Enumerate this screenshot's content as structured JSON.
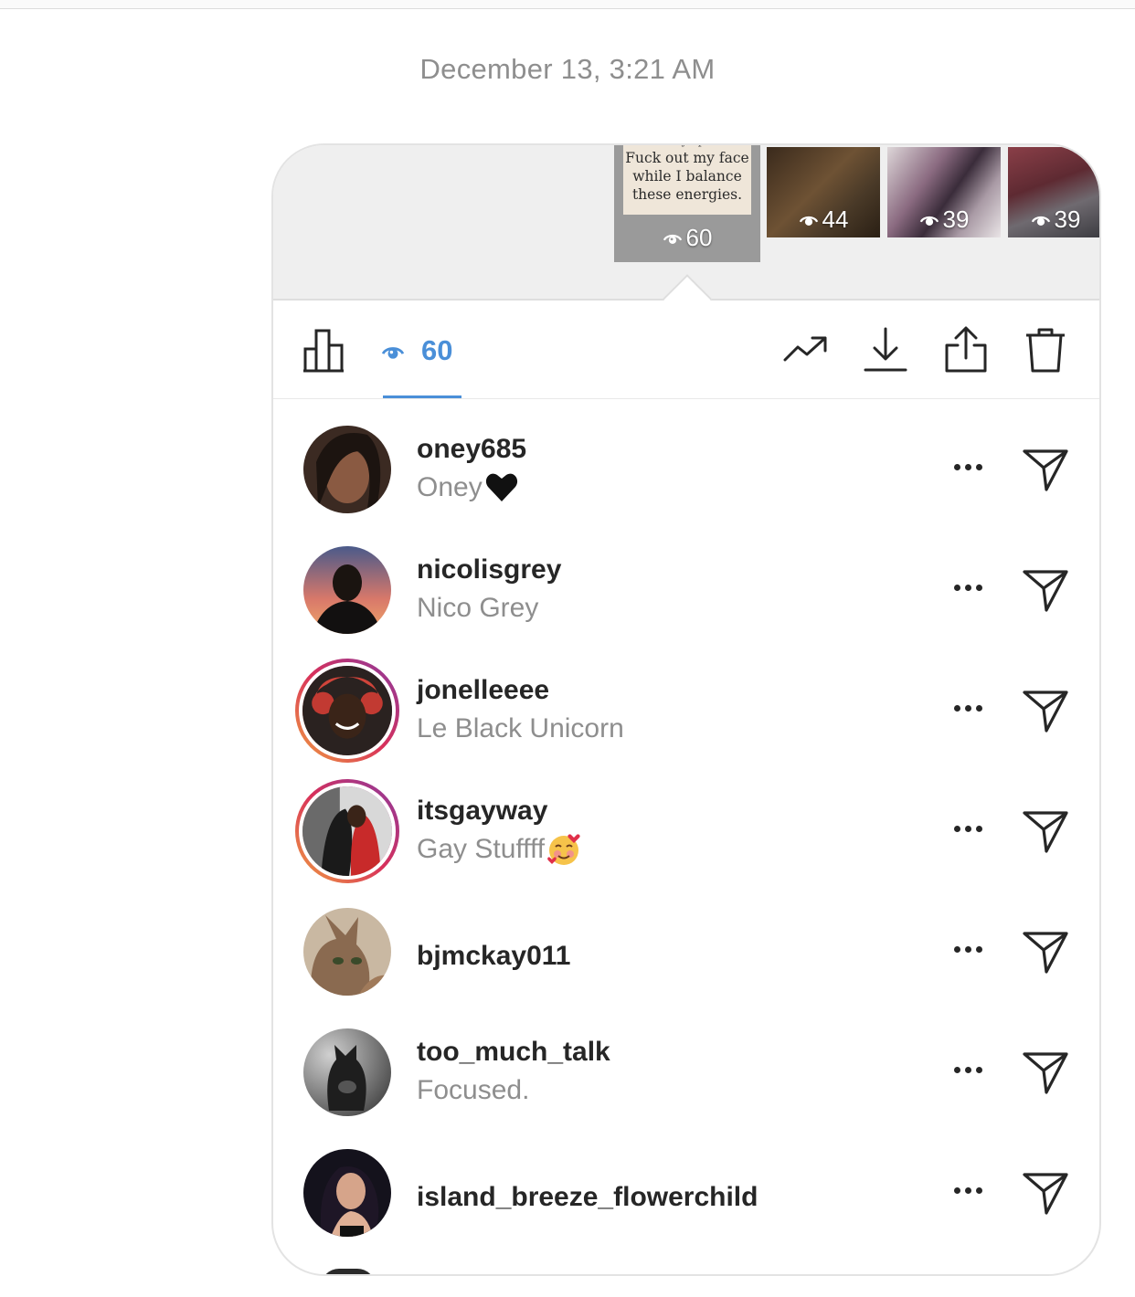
{
  "timestamp": "December 13, 3:21 AM",
  "stories": [
    {
      "quote_top": "are always positive",
      "quote": "Fuck out my face while I balance these energies.",
      "views": "60",
      "selected": true
    },
    {
      "views": "44"
    },
    {
      "views": "39"
    },
    {
      "views": "39"
    }
  ],
  "toolbar": {
    "insights_icon": "bar-chart-icon",
    "viewer_icon": "eye-icon",
    "viewer_count": "60",
    "promote_icon": "trending-up-icon",
    "download_icon": "download-icon",
    "share_icon": "share-icon",
    "delete_icon": "trash-icon",
    "accent_color": "#4a8fd8"
  },
  "viewers": [
    {
      "username": "oney685",
      "full_name": "Oney",
      "emoji": "black-heart",
      "has_story_ring": false
    },
    {
      "username": "nicolisgrey",
      "full_name": "Nico Grey",
      "emoji": "",
      "has_story_ring": false
    },
    {
      "username": "jonelleeee",
      "full_name": "Le Black Unicorn",
      "emoji": "",
      "has_story_ring": true
    },
    {
      "username": "itsgayway",
      "full_name": "Gay Stuffff",
      "emoji": "smiling-face-with-hearts",
      "has_story_ring": true
    },
    {
      "username": "bjmckay011",
      "full_name": "",
      "emoji": "",
      "has_story_ring": false
    },
    {
      "username": "too_much_talk",
      "full_name": "Focused.",
      "emoji": "",
      "has_story_ring": false
    },
    {
      "username": "island_breeze_flowerchild",
      "full_name": "",
      "emoji": "",
      "has_story_ring": false
    }
  ],
  "row_actions": {
    "more_icon": "more-horizontal-icon",
    "send_icon": "send-icon"
  }
}
